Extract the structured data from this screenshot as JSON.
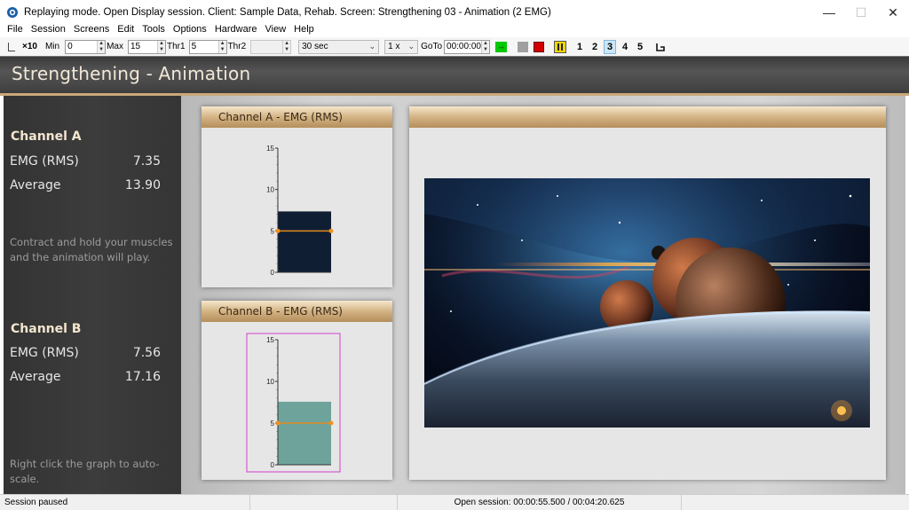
{
  "window": {
    "title": "Replaying mode. Open Display session. Client: Sample Data, Rehab. Screen: Strengthening 03 - Animation (2 EMG)",
    "minimize": "—",
    "maximize": "☐",
    "close": "✕"
  },
  "menu": [
    "File",
    "Session",
    "Screens",
    "Edit",
    "Tools",
    "Options",
    "Hardware",
    "View",
    "Help"
  ],
  "toolbar": {
    "scale_label": "×10",
    "min_label": "Min",
    "min_value": "0",
    "max_label": "Max",
    "max_value": "15",
    "thr1_label": "Thr1",
    "thr1_value": "5",
    "thr2_label": "Thr2",
    "thr2_value": "",
    "duration": "30 sec",
    "speed": "1 x",
    "goto_label": "GoTo",
    "goto_value": "00:00:00",
    "screen_numbers": [
      "1",
      "2",
      "3",
      "4",
      "5"
    ],
    "active_screen": "3",
    "colors": {
      "green": "#00c800",
      "gray": "#a0a0a0",
      "red": "#d40000",
      "yellow": "#f2d600"
    }
  },
  "header": {
    "title": "Strengthening - Animation"
  },
  "left": {
    "channel_a": {
      "title": "Channel A",
      "emg_label": "EMG (RMS)",
      "emg_value": "7.35",
      "avg_label": "Average",
      "avg_value": "13.90"
    },
    "note_a": [
      "Contract and hold your muscles",
      "and the animation will play."
    ],
    "channel_b": {
      "title": "Channel B",
      "emg_label": "EMG (RMS)",
      "emg_value": "7.56",
      "avg_label": "Average",
      "avg_value": "17.16"
    },
    "note_b": "Right click the graph to auto-scale."
  },
  "panels": {
    "a_title": "Channel A - EMG (RMS)",
    "b_title": "Channel B - EMG (RMS)",
    "anim_title": ""
  },
  "chart_data": [
    {
      "type": "bar",
      "title": "Channel A - EMG (RMS)",
      "ylim": [
        0,
        15
      ],
      "yticks": [
        0,
        5,
        10,
        15
      ],
      "value": 7.35,
      "threshold": 5,
      "bar_color": "#0f1e33"
    },
    {
      "type": "bar",
      "title": "Channel B - EMG (RMS)",
      "ylim": [
        0,
        15
      ],
      "yticks": [
        0,
        5,
        10,
        15
      ],
      "value": 7.56,
      "threshold": 5,
      "bar_color": "#6ea39b",
      "selected": true
    }
  ],
  "status": {
    "left": "Session paused",
    "center": "Open session: 00:00:55.500 / 00:04:20.625"
  }
}
